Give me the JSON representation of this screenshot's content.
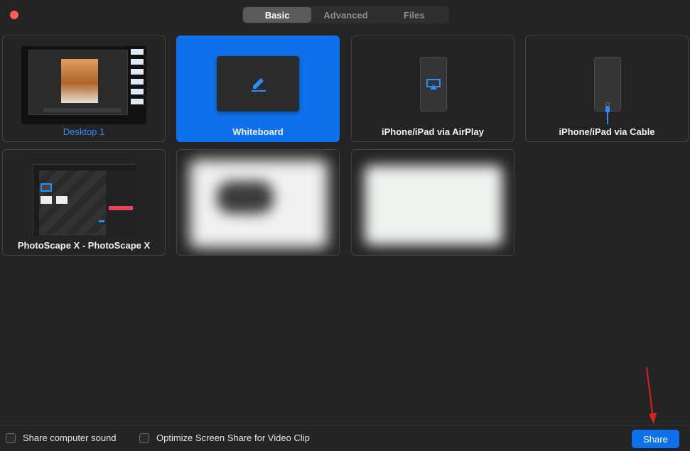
{
  "window": {
    "close_color": "#fe5f57"
  },
  "tabs": [
    {
      "label": "Basic",
      "active": true
    },
    {
      "label": "Advanced",
      "active": false
    },
    {
      "label": "Files",
      "active": false
    }
  ],
  "tiles": {
    "desktop": {
      "label": "Desktop 1"
    },
    "whiteboard": {
      "label": "Whiteboard",
      "icon": "pen-icon"
    },
    "airplay": {
      "label": "iPhone/iPad via AirPlay",
      "icon": "airplay-icon"
    },
    "cable": {
      "label": "iPhone/iPad via Cable",
      "icon": "cable-icon"
    },
    "photoscape": {
      "label": "PhotoScape X - PhotoScape X"
    }
  },
  "footer": {
    "share_sound": "Share computer sound",
    "optimize": "Optimize Screen Share for Video Clip",
    "share_button": "Share"
  },
  "colors": {
    "accent": "#0e71eb",
    "annotation_arrow": "#e0201b"
  }
}
